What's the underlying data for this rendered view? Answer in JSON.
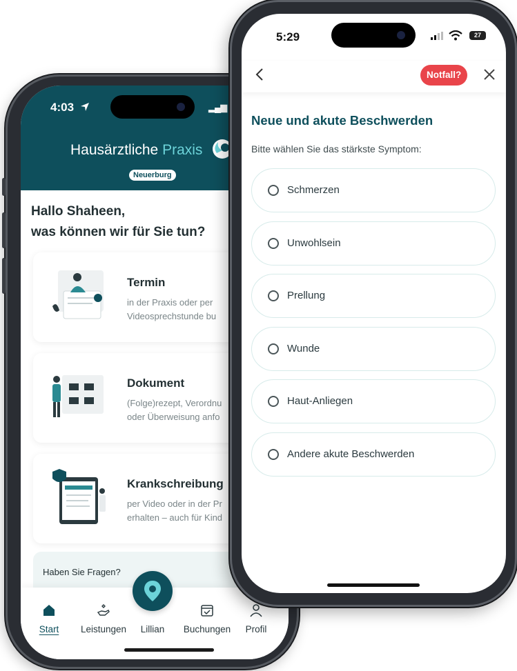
{
  "back_phone": {
    "status": {
      "time": "4:03"
    },
    "header": {
      "brand_primary": "Hausärztliche",
      "brand_secondary": "Praxis",
      "location": "Neuerburg"
    },
    "greeting": {
      "line1": "Hallo Shaheen,",
      "line2": "was können wir für Sie tun?"
    },
    "services": [
      {
        "title": "Termin",
        "desc_line1": "in der Praxis oder per",
        "desc_line2": "Videosprechstunde bu"
      },
      {
        "title": "Dokument",
        "desc_line1": "(Folge)rezept, Verordnu",
        "desc_line2": "oder Überweisung anfo"
      },
      {
        "title": "Krankschreibung",
        "desc_line1": "per Video oder in der Pr",
        "desc_line2": "erhalten – auch für Kind"
      }
    ],
    "help": {
      "text": "Haben Sie Fragen?"
    },
    "tabbar": {
      "items": [
        {
          "label": "Start",
          "icon": "home-icon",
          "active": true
        },
        {
          "label": "Leistungen",
          "icon": "hand-heart-icon",
          "active": false
        },
        {
          "label": "Lillian",
          "icon": "location-pin-icon",
          "active": false
        },
        {
          "label": "Buchungen",
          "icon": "calendar-check-icon",
          "active": false
        },
        {
          "label": "Profil",
          "icon": "person-icon",
          "active": false
        }
      ]
    },
    "colors": {
      "brand": "#0e4f5c",
      "accent": "#6cd3d9"
    }
  },
  "front_phone": {
    "status": {
      "time": "5:29",
      "battery": "27"
    },
    "navbar": {
      "back_icon": "chevron-left-icon",
      "emergency_label": "Notfall?",
      "close_icon": "close-icon"
    },
    "title": "Neue und akute Beschwerden",
    "subtitle": "Bitte wählen Sie das stärkste Symptom:",
    "options": [
      {
        "label": "Schmerzen"
      },
      {
        "label": "Unwohlsein"
      },
      {
        "label": "Prellung"
      },
      {
        "label": "Wunde"
      },
      {
        "label": "Haut-Anliegen"
      },
      {
        "label": "Andere akute Beschwerden"
      }
    ],
    "colors": {
      "title": "#0e4f5c",
      "emergency": "#e9444a",
      "option_border": "#d7ebea"
    }
  }
}
